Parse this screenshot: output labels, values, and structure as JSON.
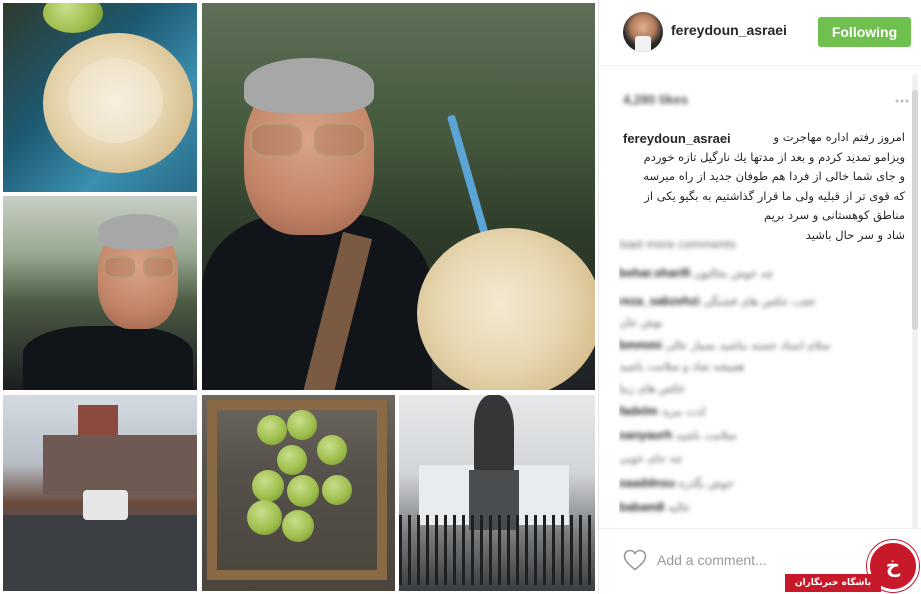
{
  "post": {
    "username": "fereydoun_asraei",
    "follow_label": "Following",
    "likes": "4,280 likes",
    "caption": "امروز رفتم اداره مهاجرت و\nویزامو تمدید کردم و بعد از مدتها یك نارگیل تازه خوردم\nو جای شما خالی از فردا هم طوفان جدید از راه میرسه\nکه قوی تر از قبلیه ولی ما قرار گذاشتیم به بگیو یکی از\nمناطق کوهستانی و سرد بریم\nشاد و سر حال باشید"
  },
  "comments": [
    {
      "user": "",
      "text": "load more comments"
    },
    {
      "user": "behar.sharifi",
      "text": "چه خوش بحالتون"
    },
    {
      "user": "reza_sabzehzi",
      "text": "عجب عکس های قشنگی"
    },
    {
      "user": "",
      "text": "نوش جان"
    },
    {
      "user": "bmmmi",
      "text": "سلام استاد خسته نباشید بسیار عالی"
    },
    {
      "user": "",
      "text": "همیشه شاد و سلامت باشید"
    },
    {
      "user": "",
      "text": "عکس های زیبا"
    },
    {
      "user": "fadelm",
      "text": "لذت ببرید"
    },
    {
      "user": "sanyaurh",
      "text": "سلامت باشید"
    },
    {
      "user": "",
      "text": "چه جای خوبی"
    },
    {
      "user": "saaddnsu",
      "text": "خوش بگذره"
    },
    {
      "user": "babam8",
      "text": "عالیه"
    }
  ],
  "comment_box": {
    "placeholder": "Add a comment..."
  },
  "watermark": {
    "logo_text": "خ",
    "label": "باشگاه خبرنگاران"
  },
  "icons": {
    "more": "more-dots-icon",
    "like": "heart-icon"
  },
  "colors": {
    "follow_button": "#70c050",
    "watermark": "#c8192a"
  }
}
